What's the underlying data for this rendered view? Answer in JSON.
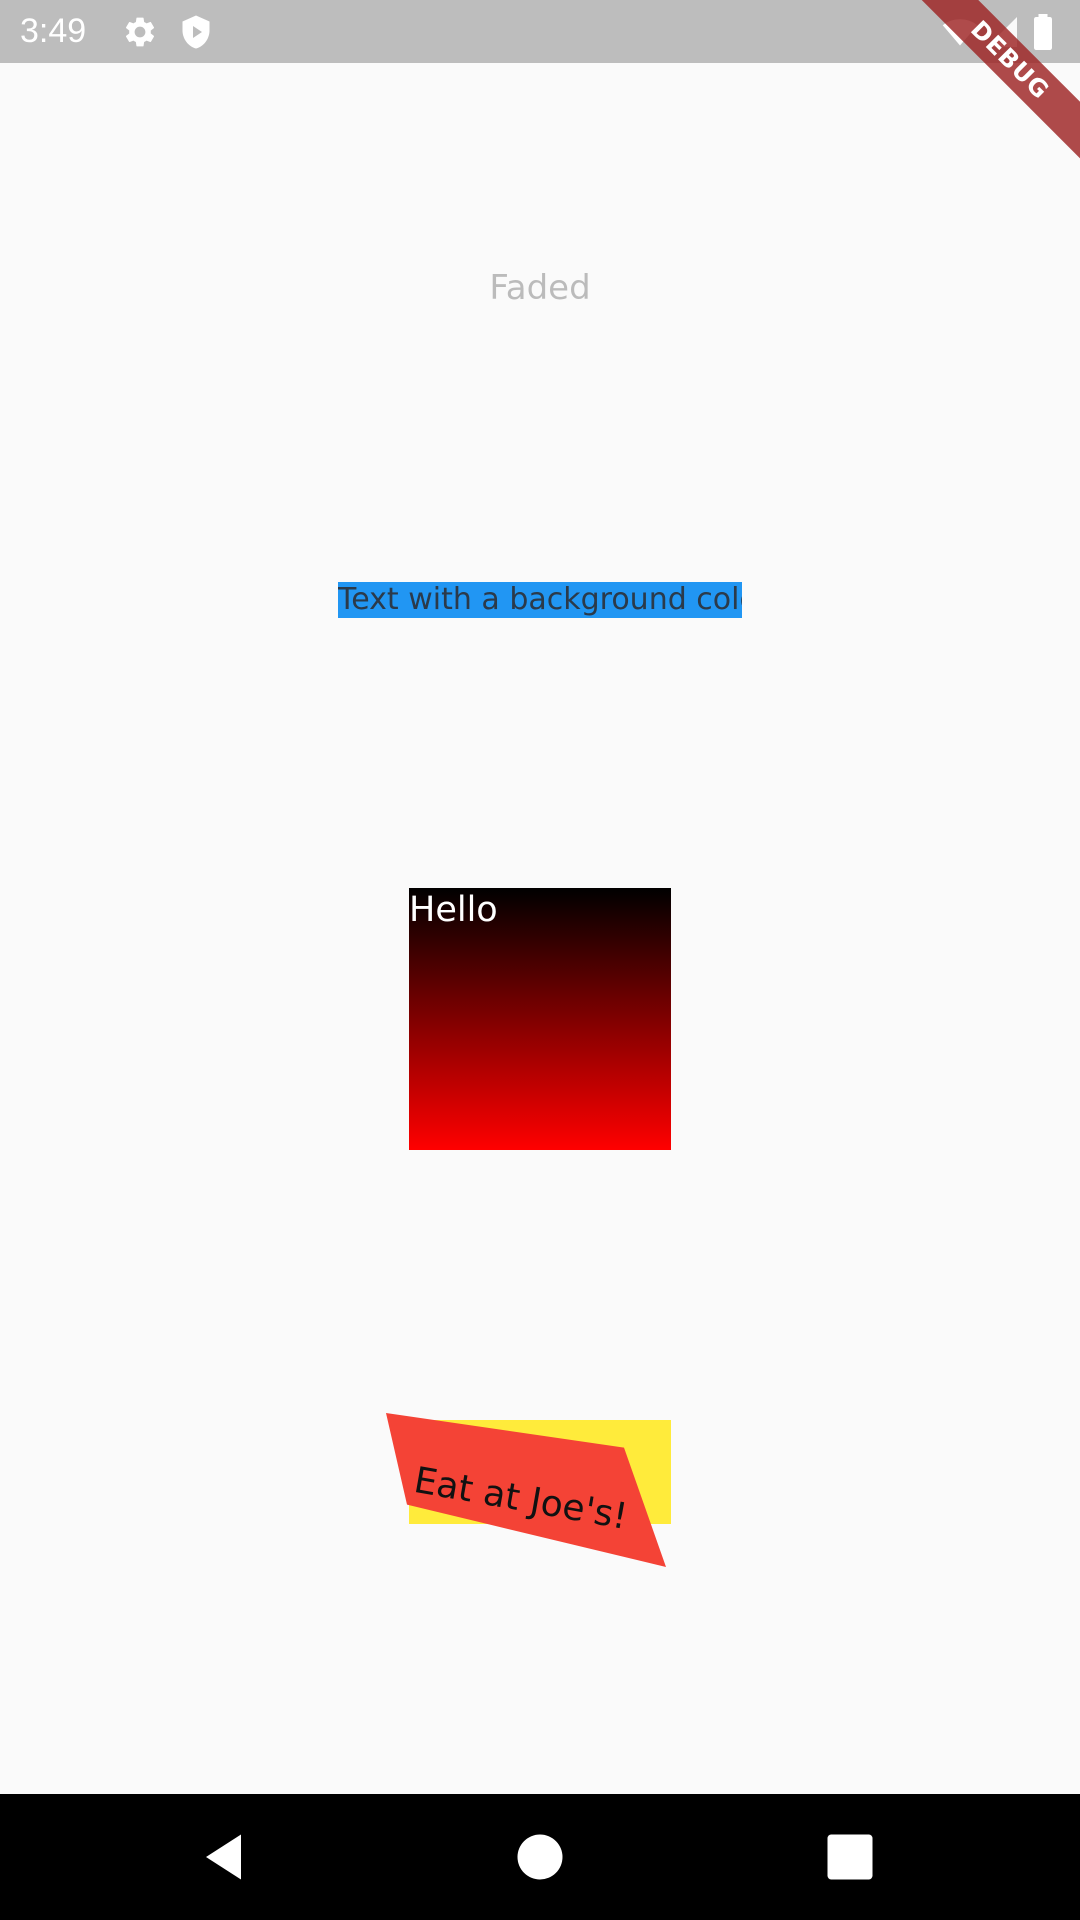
{
  "status_bar": {
    "time": "3:49",
    "icons": [
      "gear-icon",
      "shield-icon",
      "wifi-icon",
      "signal-icon",
      "battery-icon"
    ]
  },
  "debug_banner": {
    "label": "DEBUG"
  },
  "content": {
    "faded_text": "Faded",
    "background_text": "Text with a background color",
    "gradient_box": {
      "label": "Hello",
      "colors": [
        "#000000",
        "#ff0000"
      ]
    },
    "sign": {
      "text": "Eat at Joe's!",
      "front_color": "#f44336",
      "back_color": "#ffeb3b"
    }
  },
  "nav_bar": {
    "buttons": [
      "back-icon",
      "home-icon",
      "recents-icon"
    ]
  },
  "colors": {
    "page_background": "#fafafa",
    "status_bar": "#bdbdbd",
    "highlight_background": "#2196f3"
  }
}
